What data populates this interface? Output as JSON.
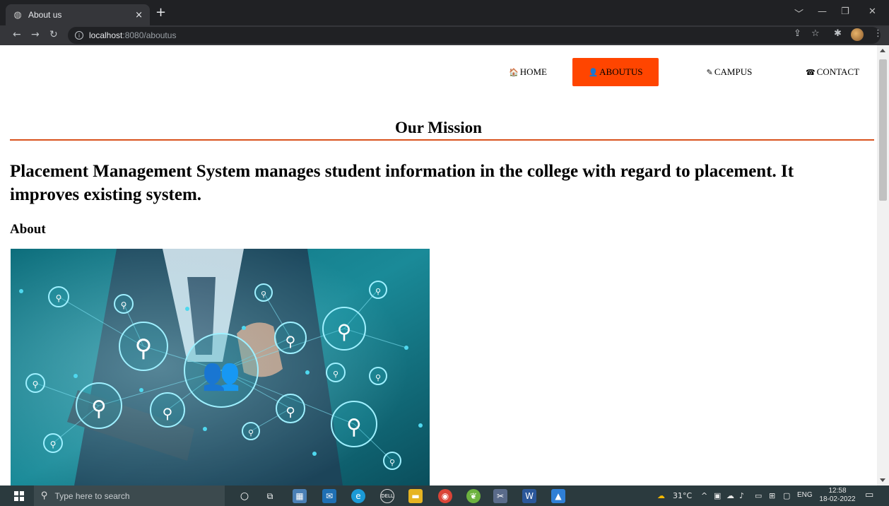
{
  "browser": {
    "tab_title": "About us",
    "tab_close": "×",
    "new_tab": "+",
    "url_host": "localhost",
    "url_rest": ":8080/aboutus",
    "window_controls": [
      "﹀",
      "—",
      "❐",
      "✕"
    ]
  },
  "nav": {
    "items": [
      {
        "icon": "🏠",
        "label": "HOME",
        "active": false
      },
      {
        "icon": "👤",
        "label": "ABOUTUS",
        "active": true
      },
      {
        "icon": "✎",
        "label": "CAMPUS",
        "active": false
      },
      {
        "icon": "☎",
        "label": "CONTACT",
        "active": false
      }
    ],
    "active_color": "#ff4500"
  },
  "page": {
    "mission_title": "Our Mission",
    "mission_text": "Placement Management System manages student information in the college with regard to placement. It improves existing system.",
    "about_heading": "About"
  },
  "taskbar": {
    "search_placeholder": "Type here to search",
    "weather": "31°C",
    "language": "ENG",
    "time": "12:58",
    "date": "18-02-2022"
  },
  "colors": {
    "accent": "#ff4500",
    "rule": "#d9531e"
  }
}
